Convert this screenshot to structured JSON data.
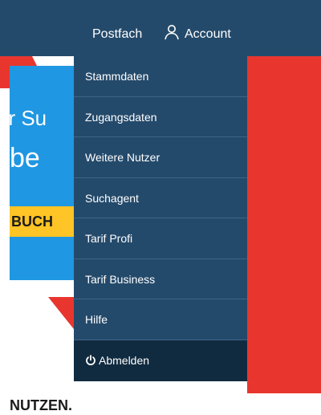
{
  "topbar": {
    "postfach_label": "Postfach",
    "account_label": "Account",
    "account_icon": "user-icon"
  },
  "hero": {
    "line1": "er Su",
    "line2": "be",
    "cta": "BUCH"
  },
  "dropdown": {
    "items": [
      {
        "label": "Stammdaten"
      },
      {
        "label": "Zugangsdaten"
      },
      {
        "label": "Weitere Nutzer"
      },
      {
        "label": "Suchagent"
      },
      {
        "label": "Tarif Profi"
      },
      {
        "label": "Tarif Business"
      },
      {
        "label": "Hilfe"
      }
    ],
    "logout_label": "Abmelden",
    "logout_icon": "power-icon"
  },
  "footer": {
    "heading_fragment": "NUTZEN."
  },
  "colors": {
    "nav_bg": "#244a6b",
    "logout_bg": "#102b40",
    "hero_blue": "#1f97e2",
    "cta_yellow": "#ffc425",
    "stripe_red": "#e8362e"
  }
}
